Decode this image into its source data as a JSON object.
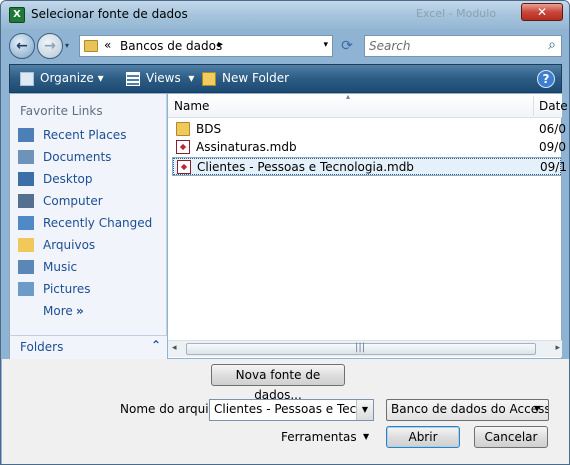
{
  "window": {
    "title": "Selecionar fonte de dados",
    "app_icon_letter": "X",
    "faded_title": "Excel - Modulo",
    "close_glyph": "✕"
  },
  "address": {
    "chevron": "«",
    "path": "Bancos de dados",
    "arrow": "▸",
    "dropdown": "▾",
    "refresh_glyph": "⟳"
  },
  "search": {
    "placeholder": "Search",
    "icon": "search-icon"
  },
  "toolbar": {
    "organize": "Organize",
    "views": "Views",
    "new_folder": "New Folder",
    "help": "?"
  },
  "sidebar": {
    "heading": "Favorite Links",
    "items": [
      {
        "label": "Recent Places",
        "icon": "recent-places-icon",
        "color": "#4a7fb8"
      },
      {
        "label": "Documents",
        "icon": "documents-icon",
        "color": "#6e93b8"
      },
      {
        "label": "Desktop",
        "icon": "desktop-icon",
        "color": "#3b6fa8"
      },
      {
        "label": "Computer",
        "icon": "computer-icon",
        "color": "#53708e"
      },
      {
        "label": "Recently Changed",
        "icon": "recently-changed-icon",
        "color": "#4f8ac7"
      },
      {
        "label": "Arquivos",
        "icon": "folder-icon",
        "color": "#f0c95a"
      },
      {
        "label": "Music",
        "icon": "music-icon",
        "color": "#5a86b8"
      },
      {
        "label": "Pictures",
        "icon": "pictures-icon",
        "color": "#6d9bc8"
      }
    ],
    "more": "More",
    "more_glyph": "»",
    "folders": "Folders",
    "folders_glyph": "⌃"
  },
  "filelist": {
    "columns": {
      "name": "Name",
      "date": "Date"
    },
    "files": [
      {
        "name": "BDS",
        "date": "06/0",
        "type": "folder"
      },
      {
        "name": "Assinaturas.mdb",
        "date": "09/0",
        "type": "mdb"
      },
      {
        "name": "Clientes - Pessoas e Tecnologia.mdb",
        "date": "09/1",
        "type": "mdb",
        "selected": true
      }
    ]
  },
  "bottom": {
    "new_source_button": "Nova fonte de dados...",
    "filename_label": "Nome do arquivo:",
    "filename_value": "Clientes - Pessoas e Tecnologia.mdb",
    "filetype_value": "Banco de dados do Access (",
    "tools_label": "Ferramentas",
    "open_button": "Abrir",
    "cancel_button": "Cancelar"
  }
}
